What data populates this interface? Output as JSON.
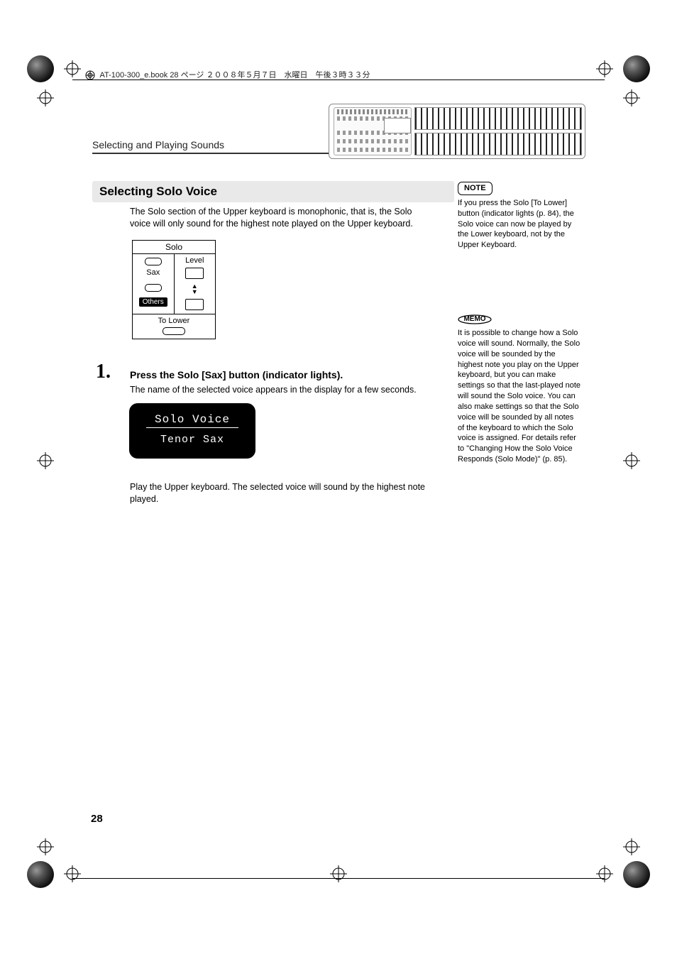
{
  "header": {
    "filename_line": "AT-100-300_e.book  28 ページ  ２００８年５月７日　水曜日　午後３時３３分"
  },
  "breadcrumb": "Selecting and Playing Sounds",
  "section": {
    "title": "Selecting Solo Voice",
    "intro": "The Solo section of the Upper keyboard is monophonic, that is, the Solo voice will only sound for the highest note played on the Upper keyboard."
  },
  "solo_panel": {
    "title": "Solo",
    "btn_sax": "Sax",
    "btn_level": "Level",
    "btn_others": "Others",
    "to_lower": "To Lower"
  },
  "step1": {
    "num": "1.",
    "head": "Press the Solo [Sax] button (indicator lights).",
    "body1": "The name of the selected voice appears in the display for a few seconds.",
    "lcd_line1": "Solo Voice",
    "lcd_line2": "Tenor Sax",
    "body2": "Play the Upper keyboard. The selected voice will sound by the highest note played."
  },
  "note": {
    "label": "NOTE",
    "text": "If you press the Solo [To Lower] button (indicator lights (p. 84), the Solo voice can now be played by the Lower keyboard, not by the Upper Keyboard."
  },
  "memo": {
    "label": "MEMO",
    "text": "It is possible to change how a Solo voice will sound. Normally, the Solo voice will be sounded by the highest note you play on the Upper keyboard, but you can make settings so that the last-played note will sound the Solo voice. You can also make settings so that the Solo voice will be sounded by all notes of the keyboard to which the Solo voice is assigned. For details refer to \"Changing How the Solo Voice Responds (Solo Mode)\" (p. 85)."
  },
  "page_number": "28"
}
